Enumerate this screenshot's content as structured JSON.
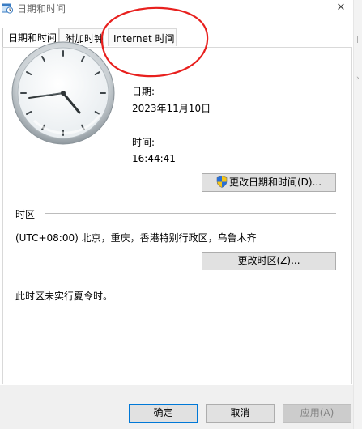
{
  "window": {
    "title": "日期和时间",
    "app_icon": "calendar-clock-icon",
    "close_glyph": "✕"
  },
  "tabs": [
    {
      "label": "日期和时间",
      "active": true
    },
    {
      "label": "附加时钟",
      "active": false
    },
    {
      "label": "Internet 时间",
      "active": false
    }
  ],
  "main": {
    "date_label": "日期:",
    "date_value": "2023年11月10日",
    "time_label": "时间:",
    "time_value": "16:44:41",
    "change_datetime_button": "更改日期和时间(D)...",
    "timezone_heading": "时区",
    "timezone_value": "(UTC+08:00) 北京，重庆，香港特别行政区，乌鲁木齐",
    "change_timezone_button": "更改时区(Z)...",
    "dst_note": "此时区未实行夏令时。"
  },
  "footer": {
    "ok_button": "确定",
    "cancel_button": "取消",
    "apply_button": "应用(A)"
  },
  "colors": {
    "annotation": "#e8201e",
    "primary_border": "#0078d7"
  }
}
